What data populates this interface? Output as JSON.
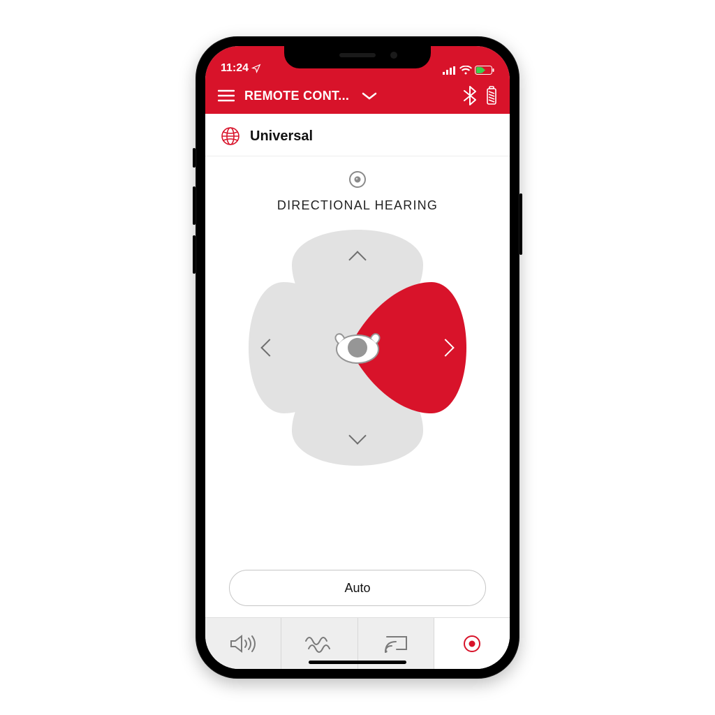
{
  "status": {
    "time": "11:24"
  },
  "header": {
    "title": "REMOTE CONT..."
  },
  "program": {
    "name": "Universal"
  },
  "section": {
    "title": "DIRECTIONAL HEARING"
  },
  "directional": {
    "active": "right"
  },
  "auto_button": {
    "label": "Auto"
  },
  "colors": {
    "accent": "#d8132a"
  }
}
